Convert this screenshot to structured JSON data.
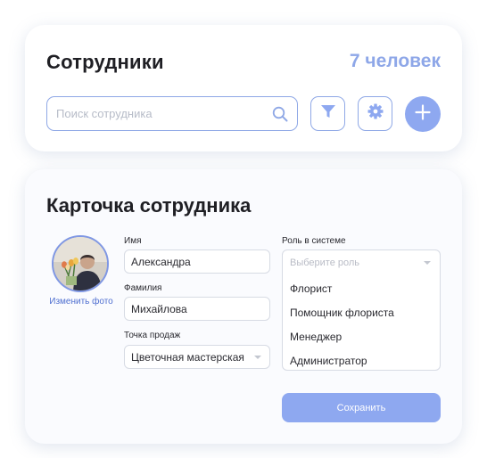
{
  "staff": {
    "title": "Сотрудники",
    "count": "7 человек",
    "search": {
      "placeholder": "Поиск сотрудника",
      "icon": "search-icon"
    },
    "buttons": {
      "filter_icon": "filter-icon",
      "settings_icon": "gear-icon",
      "add_icon": "plus-icon"
    }
  },
  "profile": {
    "title": "Карточка сотрудника",
    "change_photo": "Изменить фото",
    "first_name": {
      "label": "Имя",
      "value": "Александра"
    },
    "last_name": {
      "label": "Фамилия",
      "value": "Михайлова"
    },
    "point_of_sale": {
      "label": "Точка продаж",
      "value": "Цветочная мастерская"
    },
    "role": {
      "label": "Роль в системе",
      "placeholder": "Выберите роль",
      "options": [
        "Флорист",
        "Помощник флориста",
        "Менеджер",
        "Администратор"
      ]
    },
    "save_label": "Сохранить"
  },
  "colors": {
    "accent": "#8ea8f0",
    "accent_border": "#8fa8e6",
    "count_text": "#8ea7e8",
    "link": "#4f6fd0"
  }
}
